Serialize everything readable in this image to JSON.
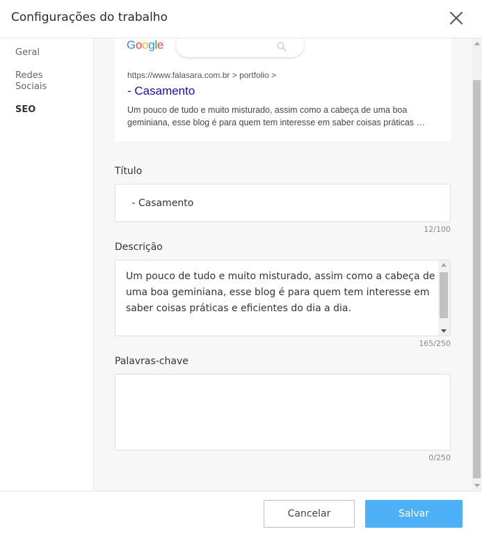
{
  "header": {
    "title": "Configurações do trabalho"
  },
  "sidebar": {
    "items": [
      {
        "label": "Geral",
        "active": false
      },
      {
        "label": "Redes Sociais",
        "active": false
      },
      {
        "label": "SEO",
        "active": true
      }
    ]
  },
  "preview": {
    "logo": {
      "letters": [
        "G",
        "o",
        "o",
        "g",
        "l",
        "e"
      ],
      "colors": [
        "#4285f4",
        "#ea4335",
        "#fbbc05",
        "#4285f4",
        "#34a853",
        "#ea4335"
      ]
    },
    "search_icon": "search-icon",
    "url": "https://www.falasara.com.br > portfolio >",
    "title": "- Casamento",
    "description_line1": "Um pouco de tudo e muito misturado, assim como a cabeça de uma boa",
    "description_line2": "geminiana, esse blog é para quem tem interesse em saber coisas práticas …"
  },
  "fields": {
    "title": {
      "label": "Título",
      "value": " - Casamento",
      "counter": "12/100"
    },
    "description": {
      "label": "Descrição",
      "value": "Um pouco de tudo e muito misturado, assim como a cabeça de uma boa geminiana, esse blog é para quem tem interesse em saber coisas práticas e eficientes do dia a dia.",
      "counter": "165/250"
    },
    "keywords": {
      "label": "Palavras-chave",
      "value": "",
      "counter": "0/250"
    }
  },
  "footer": {
    "cancel_label": "Cancelar",
    "save_label": "Salvar"
  },
  "colors": {
    "accent": "#4eb1f7",
    "link": "#1a0dab"
  }
}
